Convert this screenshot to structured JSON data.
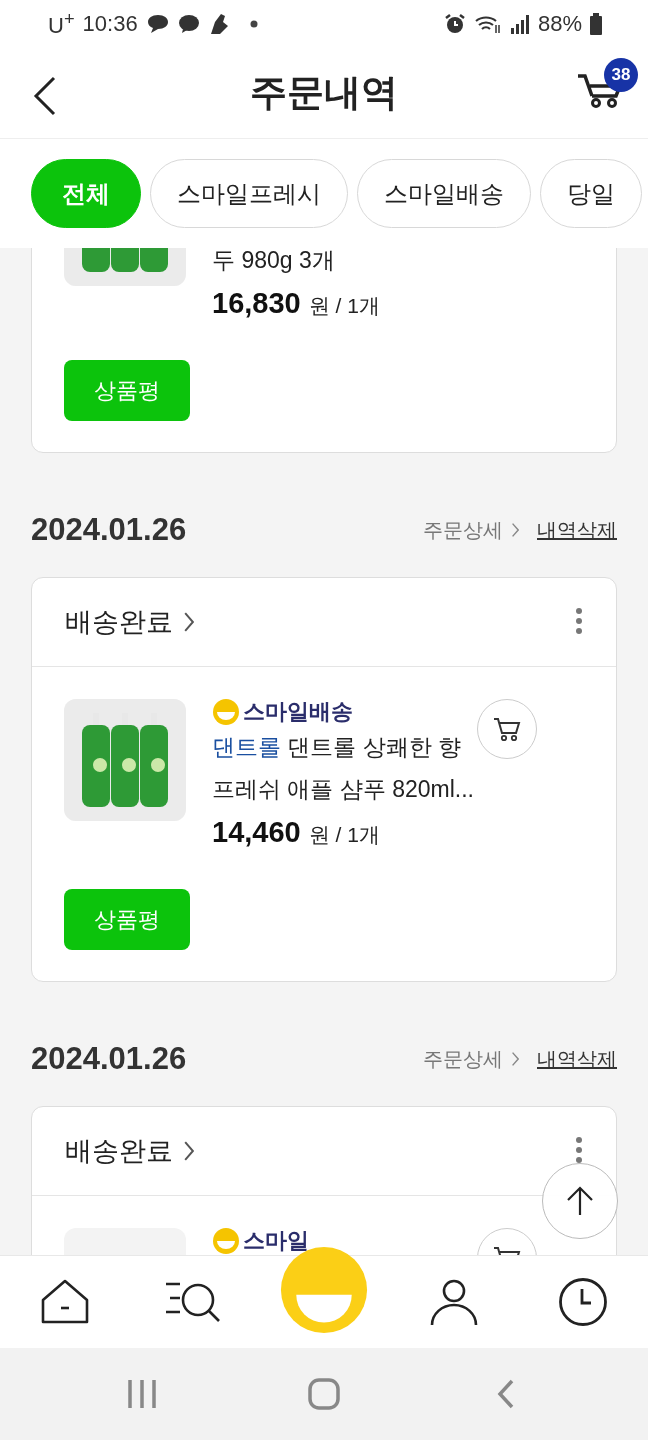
{
  "status_bar": {
    "carrier": "U$^{+}$",
    "time": "10:36",
    "battery": "88%"
  },
  "header": {
    "title": "주문내역",
    "cart_count": "38"
  },
  "tabs": [
    {
      "label": "전체",
      "selected": true
    },
    {
      "label": "스마일프레시",
      "selected": false
    },
    {
      "label": "스마일배송",
      "selected": false
    },
    {
      "label": "당일",
      "selected": false
    }
  ],
  "orders": [
    {
      "items": [
        {
          "name": "두 980g 3개",
          "price": "16,830",
          "unit": "원 / 1개",
          "review_button": "상품평"
        }
      ]
    },
    {
      "date": "2024.01.26",
      "detail_link": "주문상세",
      "delete_link": "내역삭제",
      "status": "배송완료",
      "items": [
        {
          "shipping": "스마일배송",
          "brand": "댄트롤",
          "name": "댄트롤 상쾌한 향 프레쉬 애플 샴푸 820ml...",
          "price": "14,460",
          "unit": "원 / 1개",
          "review_button": "상품평"
        }
      ]
    },
    {
      "date": "2024.01.26",
      "detail_link": "주문상세",
      "delete_link": "내역삭제",
      "status": "배송완료",
      "items": [
        {
          "shipping": "스마일"
        }
      ]
    }
  ]
}
